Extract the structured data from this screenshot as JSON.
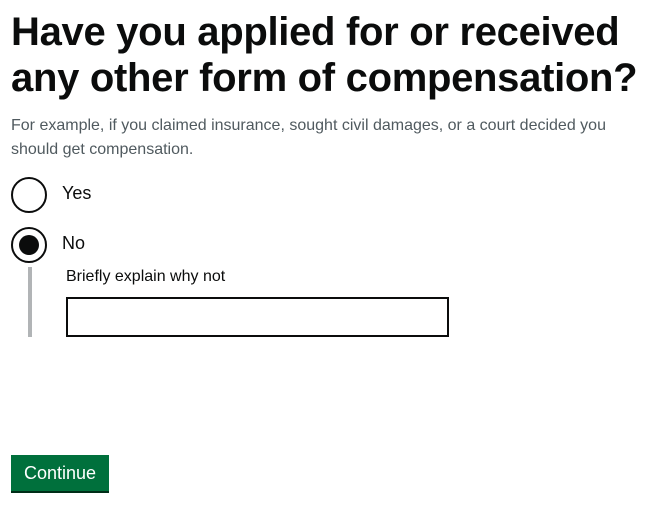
{
  "question": {
    "title": "Have you applied for or received any other form of compensation?",
    "hint": "For example, if you claimed insurance, sought civil damages, or a court decided you should get compensation."
  },
  "radios": {
    "options": [
      {
        "label": "Yes",
        "selected": false
      },
      {
        "label": "No",
        "selected": true
      }
    ]
  },
  "conditional": {
    "label": "Briefly explain why not",
    "value": ""
  },
  "actions": {
    "continue_label": "Continue"
  },
  "colors": {
    "text": "#0b0c0c",
    "hint": "#505a5f",
    "button": "#00703c",
    "button_shadow": "#002d18",
    "conditional_bar": "#b1b4b6"
  }
}
